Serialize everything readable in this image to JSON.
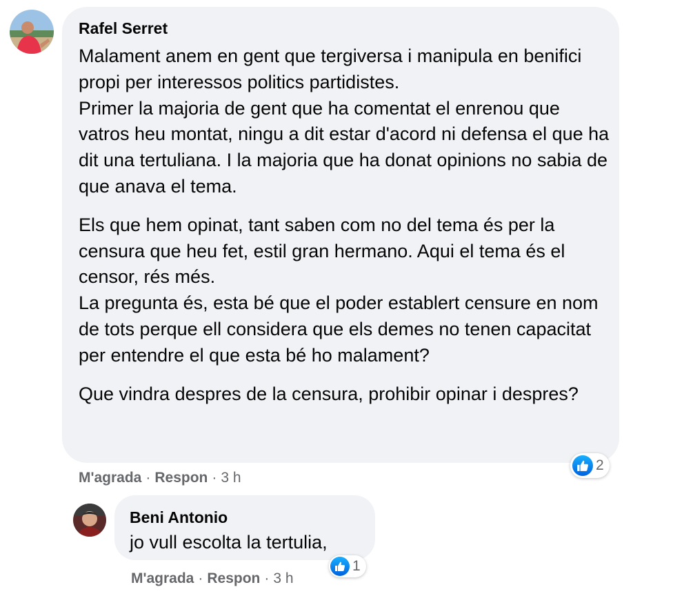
{
  "comments": [
    {
      "author": "Rafel Serret",
      "paragraphs": [
        "Malament anem en gent que tergiversa i manipula en benifici propi per interessos politics partidistes.",
        "Primer la majoria de gent que ha comentat el enrenou que vatros heu montat, ningu a dit estar d'acord ni defensa el que ha dit una tertuliana. I la majoria que ha donat opinions no sabia de que anava el tema.",
        "Els que hem opinat, tant saben com no del tema és per la censura que heu fet, estil gran hermano. Aqui el tema és el censor, rés més.",
        "La pregunta és, esta bé que el poder establert censure en nom de tots perque ell considera que els demes no tenen capacitat per entendre el que esta bé ho malament?",
        "Que vindra despres de la censura, prohibir opinar i despres?"
      ],
      "like_label": "M'agrada",
      "reply_label": "Respon",
      "separator": "·",
      "time": "3 h",
      "reaction_count": "2",
      "reaction_icon": "like-icon"
    },
    {
      "author": "Beni Antonio",
      "text": "jo vull escolta la tertulia,",
      "like_label": "M'agrada",
      "reply_label": "Respon",
      "separator": "·",
      "time": "3 h",
      "reaction_count": "1",
      "reaction_icon": "like-icon"
    }
  ],
  "colors": {
    "bubble": "#f0f2f5",
    "meta_text": "#65676b",
    "like_blue": "#0866ff"
  }
}
